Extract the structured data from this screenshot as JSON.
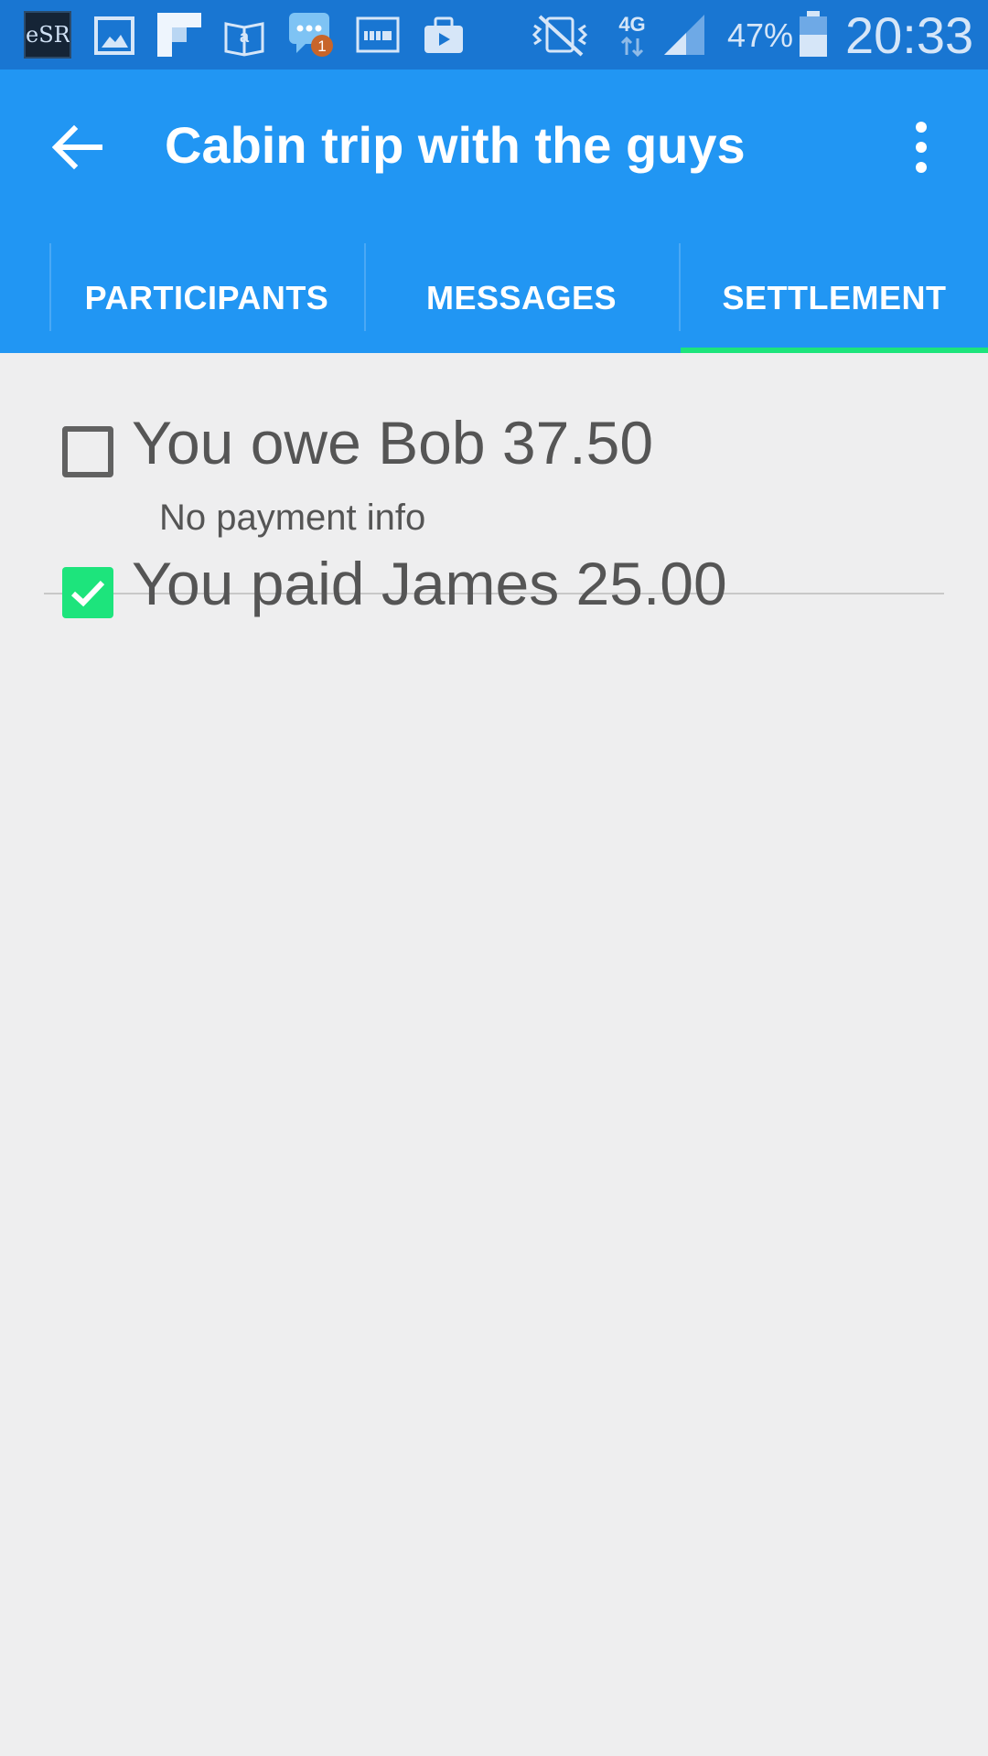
{
  "status_bar": {
    "battery_percent": "47%",
    "network_type": "4G",
    "clock": "20:33",
    "notification_badge_count": "1",
    "notification_icons": [
      "essra-icon",
      "gallery-icon",
      "flipboard-icon",
      "kindle-icon",
      "messaging-icon",
      "dtv-icon",
      "briefcase-icon"
    ],
    "color": "#1976d2"
  },
  "app_bar": {
    "title": "Cabin trip with the guys",
    "back_icon": "arrow-back-icon",
    "overflow_icon": "more-vert-icon",
    "color": "#2196f3"
  },
  "tabs": [
    {
      "label": "PARTICIPANTS",
      "selected": false
    },
    {
      "label": "MESSAGES",
      "selected": false
    },
    {
      "label": "SETTLEMENT",
      "selected": true
    }
  ],
  "accent_color": "#1de47c",
  "settlements": [
    {
      "text": "You owe Bob 37.50",
      "subtext": "No payment info",
      "checked": false
    },
    {
      "text": "You paid James 25.00",
      "subtext": "",
      "checked": true
    }
  ]
}
